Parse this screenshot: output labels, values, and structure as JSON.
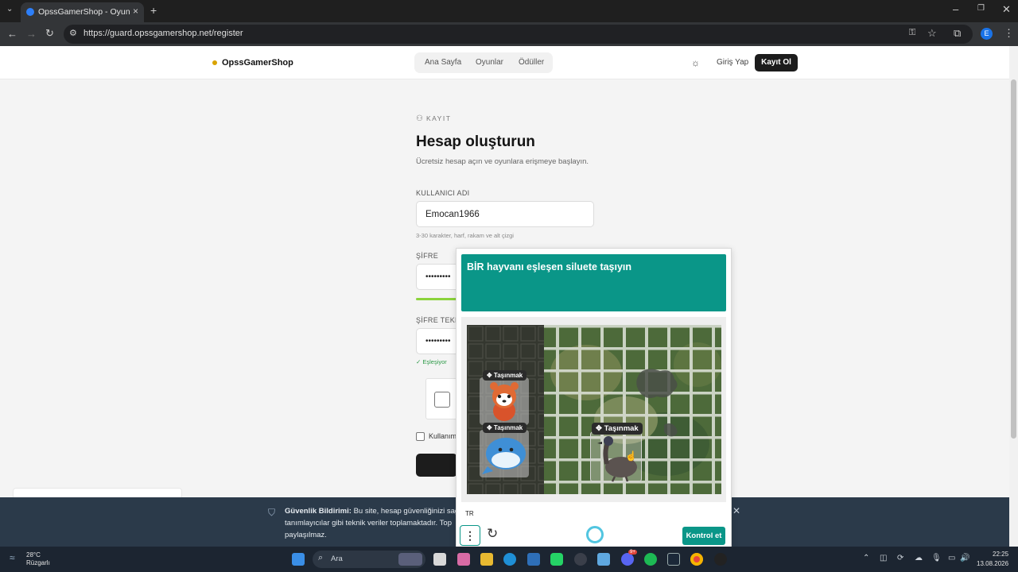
{
  "browser": {
    "tab_title": "OpssGamerShop - Oyun Mağazası",
    "url": "https://guard.opssgamershop.net/register",
    "profile_initial": "E"
  },
  "site": {
    "brand": "OpssGamerShop",
    "nav": [
      "Ana Sayfa",
      "Oyunlar",
      "Ödüller"
    ],
    "login": "Giriş Yap",
    "signup": "Kayıt Ol"
  },
  "form": {
    "eyebrow": "KAYIT",
    "title": "Hesap oluşturun",
    "subtitle": "Ücretsiz hesap açın ve oyunlara erişmeye başlayın.",
    "username_label": "KULLANICI ADI",
    "username_value": "Emocan1966",
    "username_hint": "3-30 karakter, harf, rakam ve alt çizgi",
    "password_label": "ŞİFRE",
    "password_value": "•••••••••",
    "password_repeat_label": "ŞİFRE TEKRA",
    "password_repeat_value": "•••••••••",
    "match_text": "✓ Eşleşiyor",
    "terms_text": "Kullanım"
  },
  "captcha": {
    "prompt": "BİR hayvanı eşleşen siluete taşıyın",
    "drag_label": "✥ Taşınmak",
    "language": "TR",
    "verify_button": "Kontrol et"
  },
  "banner": {
    "title": "Güvenlik Bildirimi:",
    "text": "Bu site, hesap güvenliğinizi sağ tanımlayıcılar gibi teknik veriler toplamaktadır. Top paylaşılmaz."
  },
  "taskbar": {
    "temperature": "28°C",
    "weather": "Rüzgarlı",
    "search": "Ara",
    "time": "22:25",
    "date": "13.08.2026",
    "discord_badge": "9+"
  }
}
